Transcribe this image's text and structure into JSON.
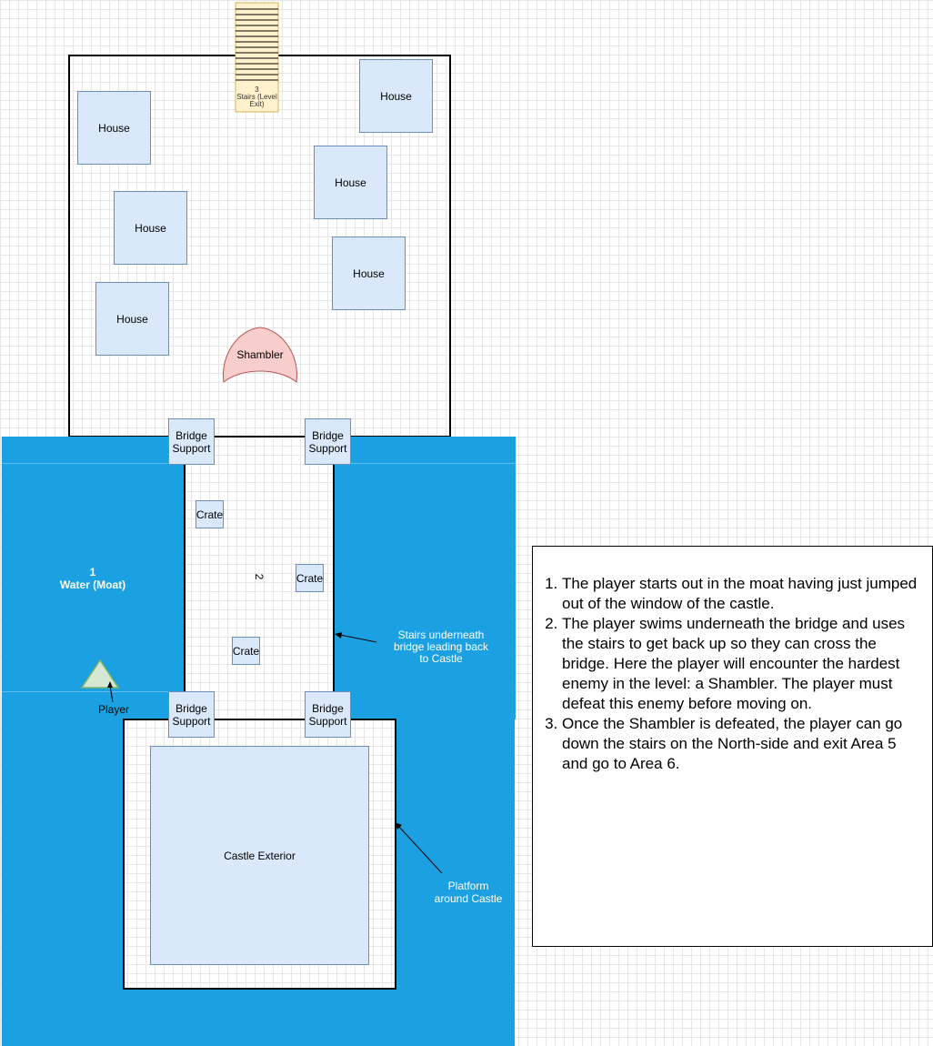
{
  "colors": {
    "water": "#1ba1e2",
    "box_fill": "#dae8fc",
    "box_stroke": "#6c8ebf",
    "enemy_fill": "#f8cecc",
    "enemy_stroke": "#b85450",
    "player_fill": "#d5e8d4",
    "player_stroke": "#82b366",
    "stairs_fill": "#fff2cc",
    "stairs_stroke": "#d6b656"
  },
  "stairs": {
    "label": "3\nStairs (Level Exit)"
  },
  "houses": [
    "House",
    "House",
    "House",
    "House",
    "House",
    "House"
  ],
  "enemy": {
    "label": "Shambler"
  },
  "bridge_supports": [
    "Bridge\nSupport",
    "Bridge\nSupport",
    "Bridge\nSupport",
    "Bridge\nSupport"
  ],
  "crates": [
    "Crate",
    "Crate",
    "Crate"
  ],
  "bridge_area_number": "2",
  "water": {
    "number": "1",
    "label": "Water (Moat)"
  },
  "player": {
    "label": "Player"
  },
  "callouts": {
    "stairs_under_bridge": "Stairs underneath\nbridge leading back\nto Castle",
    "platform": "Platform\naround Castle"
  },
  "castle": {
    "label": "Castle Exterior"
  },
  "notes": [
    "The player starts out in the moat having just jumped out of the window of the castle.",
    "The player swims underneath the bridge and uses the stairs to get back up so they can cross the bridge. Here the player will encounter the hardest enemy in the level: a Shambler. The player must defeat this enemy before moving on.",
    "Once the Shambler is defeated, the player can go down the stairs on the North-side and exit Area 5 and go to Area 6."
  ]
}
